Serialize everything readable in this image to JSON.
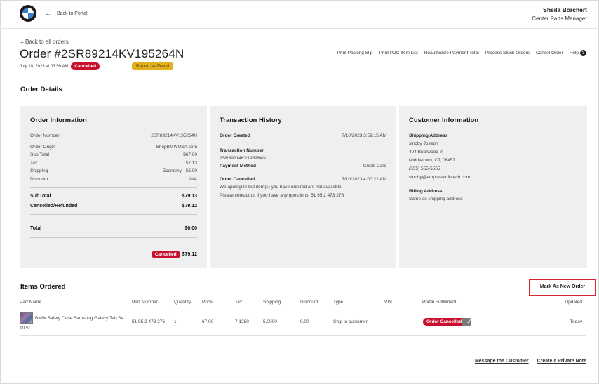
{
  "header": {
    "back_portal": "Back to Portal",
    "user_name": "Sheila Borchert",
    "user_role": "Center Parts Manager"
  },
  "order": {
    "back_link": "Back to all orders",
    "title": "Order #2SR89214KV195264N",
    "date": "July 10, 2023 at 03:59 AM",
    "status_badge": "Cancelled",
    "fraud_button": "Report as Fraud"
  },
  "actions": [
    "Print Packing Slip",
    "Print PDC Item List",
    "Reauthorize Payment Total",
    "Process Stuck Orders",
    "Cancel Order",
    "Help"
  ],
  "order_details_title": "Order Details",
  "order_information": {
    "title": "Order Information",
    "rows": [
      {
        "label": "Order Number",
        "value": "2SR89214KV195264N"
      },
      {
        "label": "Order Origin",
        "value": "ShopBMWUSA.com"
      },
      {
        "label": "Sub Total",
        "value": "$67.00"
      },
      {
        "label": "Tax",
        "value": "$7.13"
      },
      {
        "label": "Shipping",
        "value": "Economy - $5.00"
      },
      {
        "label": "Discount",
        "value": "N/A"
      }
    ],
    "subtotal_label": "SubTotal",
    "subtotal_value": "$79.13",
    "refunded_label": "Cancelled/Refunded",
    "refunded_value": "$79.12",
    "total_label": "Total",
    "total_value": "$0.00",
    "final_badge": "Cancelled",
    "final_amount": "$79.12"
  },
  "transaction_history": {
    "title": "Transaction History",
    "order_created_label": "Order Created",
    "order_created_value": "7/10/2023 3:59:15 AM",
    "transaction_number_label": "Transaction Number",
    "transaction_number_value": "2SR89214KV195264N",
    "payment_method_label": "Payment Method",
    "payment_method_value": "Credit Card",
    "order_cancelled_label": "Order Cancelled",
    "order_cancelled_value": "7/10/2023 4:00:22 AM",
    "note_line1": "We apologize but item(s) you have ordered are not available.",
    "note_line2": "Please contact us if you have any questions. 51 95 2 473 276"
  },
  "customer_information": {
    "title": "Customer Information",
    "shipping_label": "Shipping Address",
    "shipping_lines": [
      "sinoby Joseph",
      "404 Briarwood ln",
      "Middletown, CT, 06457",
      "(555) 555-5555",
      "sinoby@empressinfotech.com"
    ],
    "billing_label": "Billing Address",
    "billing_value": "Same as shipping address"
  },
  "items": {
    "title": "Items Ordered",
    "mark_new_order": "Mark As New Order",
    "columns": [
      "Part Name",
      "Part Number",
      "Quantity",
      "Price",
      "Tax",
      "Shipping",
      "Discount",
      "Type",
      "VIN",
      "Portal Fulfillment",
      "Updated"
    ],
    "rows": [
      {
        "part_name_line1": "BMW Safety Case Samsung Galaxy Tab S4",
        "part_name_line2": "10.5\"",
        "part_number": "51 95 2 473 276",
        "quantity": "1",
        "price": "67.00",
        "tax": "7.1250",
        "shipping": "5.0000",
        "discount": "0.00",
        "type": "Ship to customer",
        "vin": "",
        "fulfillment_badge": "Order Cancelled",
        "fulfillment_checked": true,
        "updated": "Today"
      }
    ]
  },
  "footer": {
    "message_customer": "Message the Customer",
    "private_note": "Create a Private Note"
  },
  "colors": {
    "cancelled_red": "#c8102e",
    "fraud_yellow": "#e0b01f",
    "panel_bg": "#efefef",
    "highlight_border": "#d9232e"
  }
}
